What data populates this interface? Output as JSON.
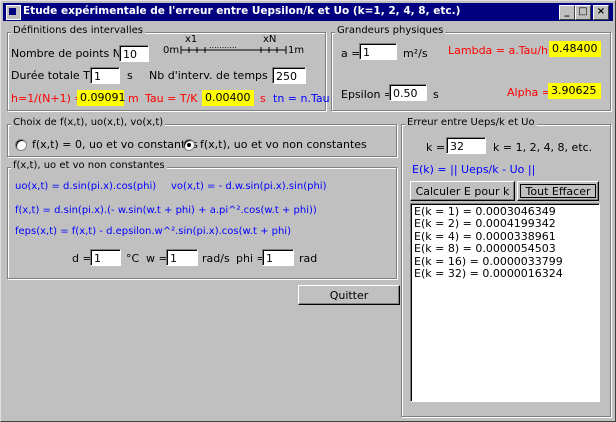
{
  "window": {
    "title": "Etude expérimentale de l'erreur entre Uepsilon/k et Uo (k=1, 2, 4, 8,  etc.)",
    "controls": [
      "_",
      "□",
      "×"
    ]
  },
  "intervals": {
    "title": "Définitions des intervalles",
    "n_label": "Nombre de points  N =",
    "n_value": "10",
    "axis_0m": "0m",
    "axis_x1": "x1",
    "axis_dots": "...........",
    "axis_xN": "xN",
    "axis_1m": "1m",
    "t_label": "Durée totale T =",
    "t_value": "1",
    "t_unit": "s",
    "k_label": "Nb d'interv. de temps K =",
    "k_value": "250",
    "h_label": "h=1/(N+1) =",
    "h_value": "0.09091",
    "h_unit": "m",
    "tau_label": "Tau = T/K =",
    "tau_value": "0.00400",
    "tau_unit": "s",
    "tn_label": "tn = n.Tau"
  },
  "physique": {
    "title": "Grandeurs physiques",
    "a_label": "a =",
    "a_value": "1",
    "a_unit": "m²/s",
    "lambda_label": "Lambda = a.Tau/h² =",
    "lambda_value": "0.48400",
    "eps_label": "Epsilon =",
    "eps_value": "0.50",
    "eps_unit": "s",
    "alpha_label": "Alpha =",
    "alpha_value": "3.90625"
  },
  "choix": {
    "title": "Choix de f(x,t), uo(x,t), vo(x,t)",
    "opt1": "f(x,t) = 0, uo et vo constantes",
    "opt2": "f(x,t), uo et vo non constantes"
  },
  "formules": {
    "title": "f(x,t), uo et vo non constantes",
    "uo": "uo(x,t) = d.sin(pi.x).cos(phi)",
    "vo": "vo(x,t) = - d.w.sin(pi.x).sin(phi)",
    "f": "f(x,t) = d.sin(pi.x).(- w.sin(w.t + phi) + a.pi^².cos(w.t + phi))",
    "feps": "feps(x,t) = f(x,t) - d.epsilon.w^².sin(pi.x).cos(w.t + phi)",
    "d_label": "d =",
    "d_value": "1",
    "d_unit": "°C",
    "w_label": "w =",
    "w_value": "1",
    "w_unit": "rad/s",
    "phi_label": "phi =",
    "phi_value": "1",
    "phi_unit": "rad"
  },
  "erreur": {
    "title": "Erreur entre Ueps/k et Uo",
    "k_label": "k =",
    "k_value": "32",
    "k_hint": "k = 1, 2, 4, 8, etc.",
    "ek_formula": "E(k) = || Ueps/k - Uo ||",
    "calc_button": "Calculer E pour k",
    "clear_button": "Tout Effacer",
    "results": [
      "E(k = 1) = 0.0003046349",
      "E(k = 2) = 0.0004199342",
      "E(k = 4) = 0.0000338961",
      "E(k = 8) = 0.0000054503",
      "E(k = 16) = 0.0000033799",
      "E(k = 32) = 0.0000016324"
    ]
  },
  "quit_button": "Quitter",
  "colors": {
    "titlebar": "#000080",
    "highlight": "#ffff00",
    "label_red": "#ff0000",
    "label_blue": "#0000ff"
  }
}
